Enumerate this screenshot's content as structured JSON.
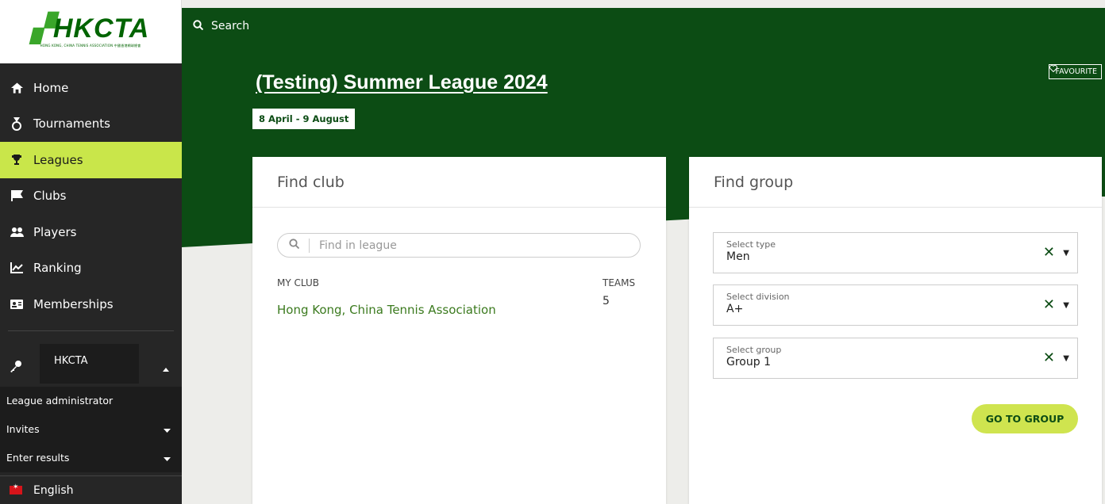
{
  "logo": {
    "main": "HKCTA",
    "sub": "HONG KONG, CHINA TENNIS ASSOCIATION 中國香港網球總會"
  },
  "search": {
    "label": "Search"
  },
  "nav": [
    {
      "label": "Home",
      "icon": "home-icon"
    },
    {
      "label": "Tournaments",
      "icon": "medal-icon"
    },
    {
      "label": "Leagues",
      "icon": "trophy-icon"
    },
    {
      "label": "Clubs",
      "icon": "flag-icon"
    },
    {
      "label": "Players",
      "icon": "users-icon"
    },
    {
      "label": "Ranking",
      "icon": "chart-icon"
    },
    {
      "label": "Memberships",
      "icon": "id-card-icon"
    }
  ],
  "admin": {
    "org": "HKCTA",
    "items": [
      {
        "label": "League administrator"
      },
      {
        "label": "Invites"
      },
      {
        "label": "Enter results"
      }
    ]
  },
  "language": {
    "label": "English"
  },
  "league": {
    "title": "(Testing) Summer League 2024",
    "dates": "8 April - 9 August",
    "favourite_label": "FAVOURITE"
  },
  "find_club": {
    "title": "Find club",
    "search_placeholder": "Find in league",
    "col_my_club": "MY CLUB",
    "col_teams": "TEAMS",
    "club_name": "Hong Kong, China Tennis Association",
    "teams": "5"
  },
  "find_group": {
    "title": "Find group",
    "selects": [
      {
        "label": "Select type",
        "value": "Men"
      },
      {
        "label": "Select division",
        "value": "A+"
      },
      {
        "label": "Select group",
        "value": "Group 1"
      }
    ],
    "go_label": "GO TO GROUP"
  },
  "colors": {
    "brand_green": "#0c4c14",
    "accent_lime": "#c9e64a",
    "sidebar": "#262626"
  }
}
